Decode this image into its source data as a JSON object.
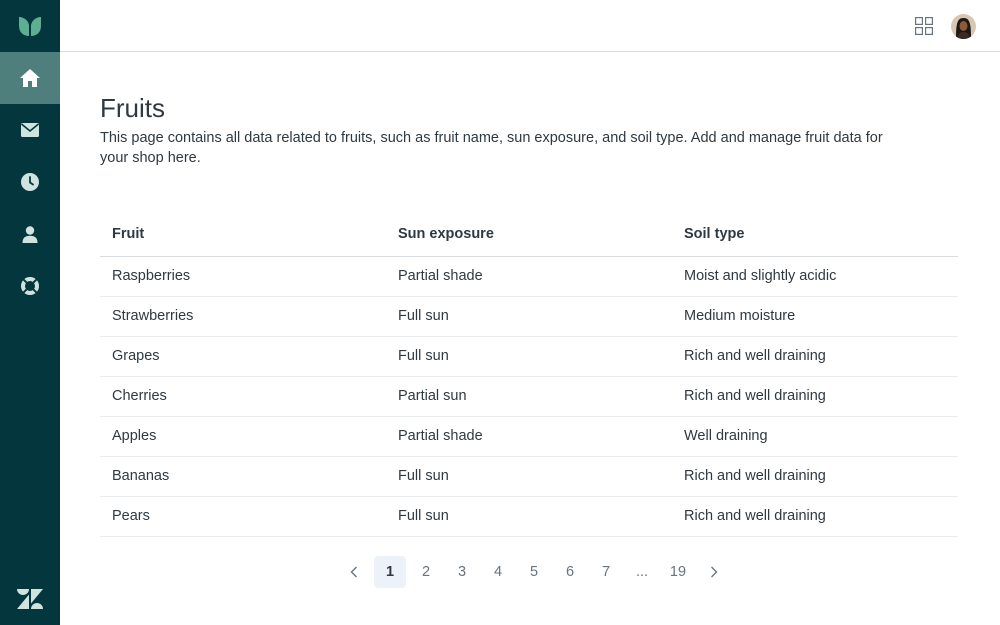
{
  "nav": {
    "items": [
      {
        "name": "home",
        "icon": "home-icon",
        "active": true
      },
      {
        "name": "mail",
        "icon": "mail-icon",
        "active": false
      },
      {
        "name": "history",
        "icon": "clock-icon",
        "active": false
      },
      {
        "name": "user",
        "icon": "user-icon",
        "active": false
      },
      {
        "name": "support",
        "icon": "lifebuoy-icon",
        "active": false
      }
    ],
    "logo_icon": "leaf-logo-icon",
    "brand_icon": "zendesk-logo-icon"
  },
  "header": {
    "apps_icon": "grid-icon",
    "avatar_icon": "user-avatar"
  },
  "page": {
    "title": "Fruits",
    "description": "This page contains all data related to fruits, such as fruit name, sun exposure, and soil type. Add and manage fruit data for your shop here."
  },
  "table": {
    "headers": [
      "Fruit",
      "Sun exposure",
      "Soil type"
    ],
    "rows": [
      [
        "Raspberries",
        "Partial shade",
        "Moist and slightly acidic"
      ],
      [
        "Strawberries",
        "Full sun",
        "Medium moisture"
      ],
      [
        "Grapes",
        "Full sun",
        "Rich and well draining"
      ],
      [
        "Cherries",
        "Partial sun",
        "Rich and well draining"
      ],
      [
        "Apples",
        "Partial shade",
        "Well draining"
      ],
      [
        "Bananas",
        "Full sun",
        "Rich and well draining"
      ],
      [
        "Pears",
        "Full sun",
        "Rich and well draining"
      ]
    ]
  },
  "pagination": {
    "prev_icon": "chevron-left-icon",
    "next_icon": "chevron-right-icon",
    "pages": [
      "1",
      "2",
      "3",
      "4",
      "5",
      "6",
      "7",
      "...",
      "19"
    ],
    "current": "1"
  },
  "colors": {
    "sidebar": "#03363d",
    "sidebar_active": "#4f7f7c",
    "accent": "#5eae91",
    "text": "#2f3941"
  }
}
